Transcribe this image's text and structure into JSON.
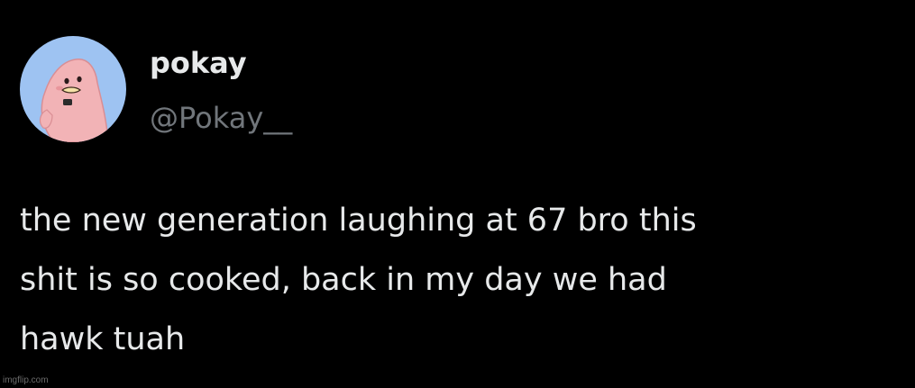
{
  "tweet": {
    "author": {
      "display_name": "pokay",
      "handle": "@Pokay__",
      "avatar_icon": "pink-cartoon-character-avatar"
    },
    "text_lines": [
      "the new generation laughing at 67 bro this",
      "shit is so cooked, back in my day we had",
      "hawk tuah"
    ]
  },
  "watermark": "imgflip.com",
  "colors": {
    "background": "#000000",
    "primary_text": "#e7e9ea",
    "secondary_text": "#71767b",
    "avatar_background": "#9ec3f2",
    "avatar_character": "#f2b3b6"
  }
}
